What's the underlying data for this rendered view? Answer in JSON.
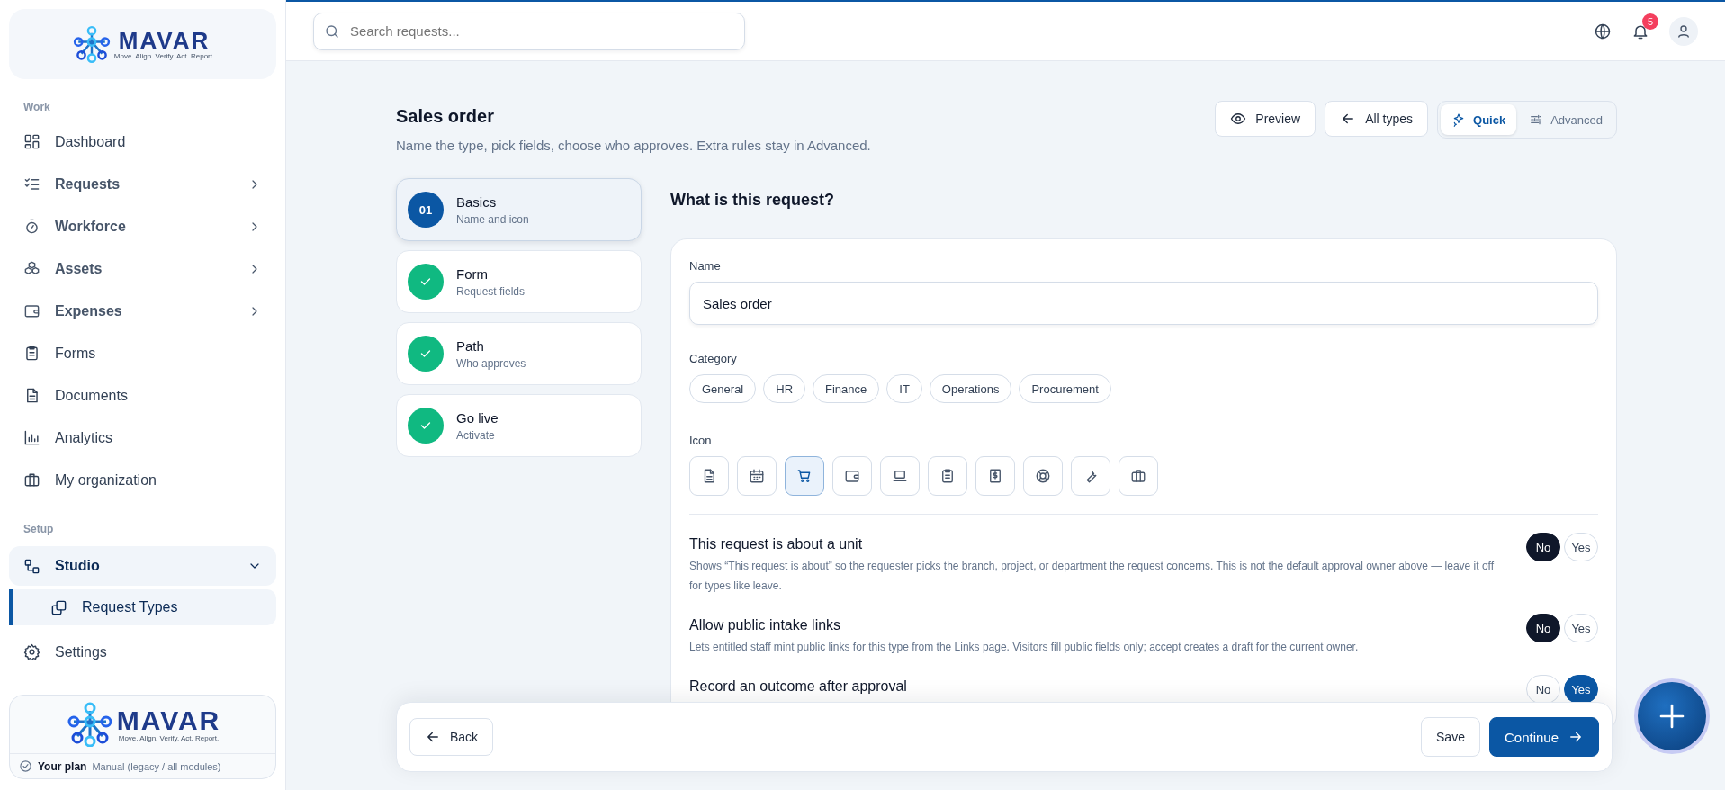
{
  "brand": {
    "name": "MAVAR",
    "tagline": "Move. Align. Verify. Act. Report."
  },
  "sidebar": {
    "sections": [
      {
        "title": "Work",
        "items": [
          {
            "label": "Dashboard",
            "has_submenu": false,
            "expanded": false,
            "selected": false
          },
          {
            "label": "Requests",
            "has_submenu": true,
            "expanded": false,
            "selected": false
          },
          {
            "label": "Workforce",
            "has_submenu": true,
            "expanded": false,
            "selected": false
          },
          {
            "label": "Assets",
            "has_submenu": true,
            "expanded": false,
            "selected": false
          },
          {
            "label": "Expenses",
            "has_submenu": true,
            "expanded": false,
            "selected": false
          },
          {
            "label": "Forms",
            "has_submenu": false,
            "expanded": false,
            "selected": false
          },
          {
            "label": "Documents",
            "has_submenu": false,
            "expanded": false,
            "selected": false
          },
          {
            "label": "Analytics",
            "has_submenu": false,
            "expanded": false,
            "selected": false
          },
          {
            "label": "My organization",
            "has_submenu": false,
            "expanded": false,
            "selected": false
          }
        ]
      },
      {
        "title": "Setup",
        "items": [
          {
            "label": "Studio",
            "has_submenu": true,
            "expanded": true,
            "selected": false,
            "children": [
              {
                "label": "Request Types",
                "selected": true
              }
            ]
          },
          {
            "label": "Settings",
            "has_submenu": false,
            "expanded": false,
            "selected": false
          }
        ]
      }
    ],
    "plan": {
      "brand_name": "MAVAR",
      "brand_tagline": "Move. Align. Verify. Act. Report.",
      "label": "Your plan",
      "value": "Manual (legacy / all modules)"
    }
  },
  "header": {
    "search": {
      "placeholder": "Search requests..."
    },
    "notifications": {
      "count": "5"
    }
  },
  "page": {
    "title": "Sales order",
    "subtitle": "Name the type, pick fields, choose who approves. Extra rules stay in Advanced.",
    "actions": [
      "Preview",
      "All types"
    ],
    "modes": [
      {
        "label": "Quick",
        "selected": true
      },
      {
        "label": "Advanced",
        "selected": false
      }
    ]
  },
  "steps": [
    {
      "number": "01",
      "title": "Basics",
      "subtitle": "Name and icon",
      "selected": true,
      "done": false
    },
    {
      "title": "Form",
      "subtitle": "Request fields",
      "selected": false,
      "done": true
    },
    {
      "title": "Path",
      "subtitle": "Who approves",
      "selected": false,
      "done": true
    },
    {
      "title": "Go live",
      "subtitle": "Activate",
      "selected": false,
      "done": true
    }
  ],
  "form": {
    "heading": "What is this request?",
    "name": {
      "label": "Name",
      "value": "Sales order"
    },
    "category": {
      "label": "Category",
      "options": [
        {
          "label": "General",
          "selected": false
        },
        {
          "label": "HR",
          "selected": false
        },
        {
          "label": "Finance",
          "selected": false
        },
        {
          "label": "IT",
          "selected": false
        },
        {
          "label": "Operations",
          "selected": false
        },
        {
          "label": "Procurement",
          "selected": false
        }
      ]
    },
    "icon": {
      "label": "Icon",
      "choices": [
        {
          "selected": false
        },
        {
          "selected": false
        },
        {
          "selected": true
        },
        {
          "selected": false
        },
        {
          "selected": false
        },
        {
          "selected": false
        },
        {
          "selected": false
        },
        {
          "selected": false
        },
        {
          "selected": false
        },
        {
          "selected": false
        }
      ]
    },
    "toggles": [
      {
        "title": "This request is about a unit",
        "description": "Shows “This request is about” so the requester picks the branch, project, or department the request concerns. This is not the default approval owner above — leave it off for types like leave.",
        "options": [
          {
            "label": "No",
            "selected": true
          },
          {
            "label": "Yes",
            "selected": false
          }
        ]
      },
      {
        "title": "Allow public intake links",
        "description": "Lets entitled staff mint public links for this type from the Links page. Visitors fill public fields only; accept creates a draft for the current owner.",
        "options": [
          {
            "label": "No",
            "selected": true
          },
          {
            "label": "Yes",
            "selected": false
          }
        ]
      },
      {
        "title": "Record an outcome after approval",
        "options": [
          {
            "label": "No",
            "selected": false
          },
          {
            "label": "Yes",
            "selected": true
          }
        ]
      }
    ]
  },
  "footer": {
    "back": "Back",
    "save": "Save",
    "continue": "Continue"
  }
}
